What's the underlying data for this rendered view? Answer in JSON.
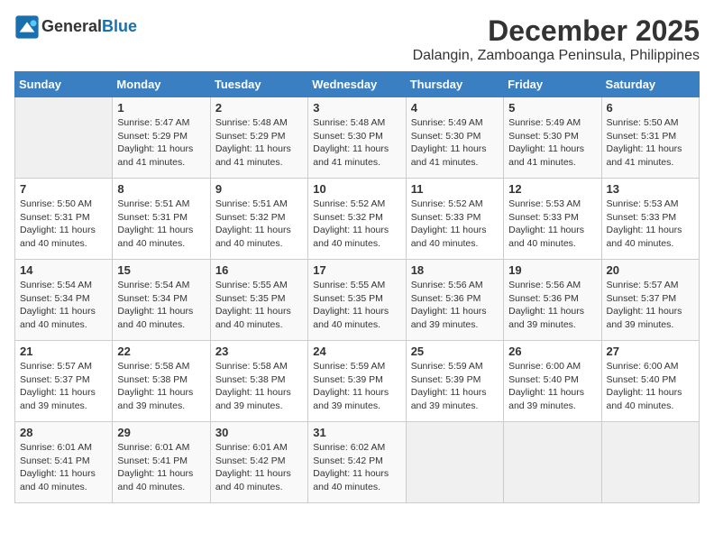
{
  "header": {
    "logo_line1": "General",
    "logo_line2": "Blue",
    "month": "December 2025",
    "location": "Dalangin, Zamboanga Peninsula, Philippines"
  },
  "days_of_week": [
    "Sunday",
    "Monday",
    "Tuesday",
    "Wednesday",
    "Thursday",
    "Friday",
    "Saturday"
  ],
  "weeks": [
    [
      {
        "day": "",
        "info": ""
      },
      {
        "day": "1",
        "info": "Sunrise: 5:47 AM\nSunset: 5:29 PM\nDaylight: 11 hours\nand 41 minutes."
      },
      {
        "day": "2",
        "info": "Sunrise: 5:48 AM\nSunset: 5:29 PM\nDaylight: 11 hours\nand 41 minutes."
      },
      {
        "day": "3",
        "info": "Sunrise: 5:48 AM\nSunset: 5:30 PM\nDaylight: 11 hours\nand 41 minutes."
      },
      {
        "day": "4",
        "info": "Sunrise: 5:49 AM\nSunset: 5:30 PM\nDaylight: 11 hours\nand 41 minutes."
      },
      {
        "day": "5",
        "info": "Sunrise: 5:49 AM\nSunset: 5:30 PM\nDaylight: 11 hours\nand 41 minutes."
      },
      {
        "day": "6",
        "info": "Sunrise: 5:50 AM\nSunset: 5:31 PM\nDaylight: 11 hours\nand 41 minutes."
      }
    ],
    [
      {
        "day": "7",
        "info": "Sunrise: 5:50 AM\nSunset: 5:31 PM\nDaylight: 11 hours\nand 40 minutes."
      },
      {
        "day": "8",
        "info": "Sunrise: 5:51 AM\nSunset: 5:31 PM\nDaylight: 11 hours\nand 40 minutes."
      },
      {
        "day": "9",
        "info": "Sunrise: 5:51 AM\nSunset: 5:32 PM\nDaylight: 11 hours\nand 40 minutes."
      },
      {
        "day": "10",
        "info": "Sunrise: 5:52 AM\nSunset: 5:32 PM\nDaylight: 11 hours\nand 40 minutes."
      },
      {
        "day": "11",
        "info": "Sunrise: 5:52 AM\nSunset: 5:33 PM\nDaylight: 11 hours\nand 40 minutes."
      },
      {
        "day": "12",
        "info": "Sunrise: 5:53 AM\nSunset: 5:33 PM\nDaylight: 11 hours\nand 40 minutes."
      },
      {
        "day": "13",
        "info": "Sunrise: 5:53 AM\nSunset: 5:33 PM\nDaylight: 11 hours\nand 40 minutes."
      }
    ],
    [
      {
        "day": "14",
        "info": "Sunrise: 5:54 AM\nSunset: 5:34 PM\nDaylight: 11 hours\nand 40 minutes."
      },
      {
        "day": "15",
        "info": "Sunrise: 5:54 AM\nSunset: 5:34 PM\nDaylight: 11 hours\nand 40 minutes."
      },
      {
        "day": "16",
        "info": "Sunrise: 5:55 AM\nSunset: 5:35 PM\nDaylight: 11 hours\nand 40 minutes."
      },
      {
        "day": "17",
        "info": "Sunrise: 5:55 AM\nSunset: 5:35 PM\nDaylight: 11 hours\nand 40 minutes."
      },
      {
        "day": "18",
        "info": "Sunrise: 5:56 AM\nSunset: 5:36 PM\nDaylight: 11 hours\nand 39 minutes."
      },
      {
        "day": "19",
        "info": "Sunrise: 5:56 AM\nSunset: 5:36 PM\nDaylight: 11 hours\nand 39 minutes."
      },
      {
        "day": "20",
        "info": "Sunrise: 5:57 AM\nSunset: 5:37 PM\nDaylight: 11 hours\nand 39 minutes."
      }
    ],
    [
      {
        "day": "21",
        "info": "Sunrise: 5:57 AM\nSunset: 5:37 PM\nDaylight: 11 hours\nand 39 minutes."
      },
      {
        "day": "22",
        "info": "Sunrise: 5:58 AM\nSunset: 5:38 PM\nDaylight: 11 hours\nand 39 minutes."
      },
      {
        "day": "23",
        "info": "Sunrise: 5:58 AM\nSunset: 5:38 PM\nDaylight: 11 hours\nand 39 minutes."
      },
      {
        "day": "24",
        "info": "Sunrise: 5:59 AM\nSunset: 5:39 PM\nDaylight: 11 hours\nand 39 minutes."
      },
      {
        "day": "25",
        "info": "Sunrise: 5:59 AM\nSunset: 5:39 PM\nDaylight: 11 hours\nand 39 minutes."
      },
      {
        "day": "26",
        "info": "Sunrise: 6:00 AM\nSunset: 5:40 PM\nDaylight: 11 hours\nand 39 minutes."
      },
      {
        "day": "27",
        "info": "Sunrise: 6:00 AM\nSunset: 5:40 PM\nDaylight: 11 hours\nand 40 minutes."
      }
    ],
    [
      {
        "day": "28",
        "info": "Sunrise: 6:01 AM\nSunset: 5:41 PM\nDaylight: 11 hours\nand 40 minutes."
      },
      {
        "day": "29",
        "info": "Sunrise: 6:01 AM\nSunset: 5:41 PM\nDaylight: 11 hours\nand 40 minutes."
      },
      {
        "day": "30",
        "info": "Sunrise: 6:01 AM\nSunset: 5:42 PM\nDaylight: 11 hours\nand 40 minutes."
      },
      {
        "day": "31",
        "info": "Sunrise: 6:02 AM\nSunset: 5:42 PM\nDaylight: 11 hours\nand 40 minutes."
      },
      {
        "day": "",
        "info": ""
      },
      {
        "day": "",
        "info": ""
      },
      {
        "day": "",
        "info": ""
      }
    ]
  ]
}
